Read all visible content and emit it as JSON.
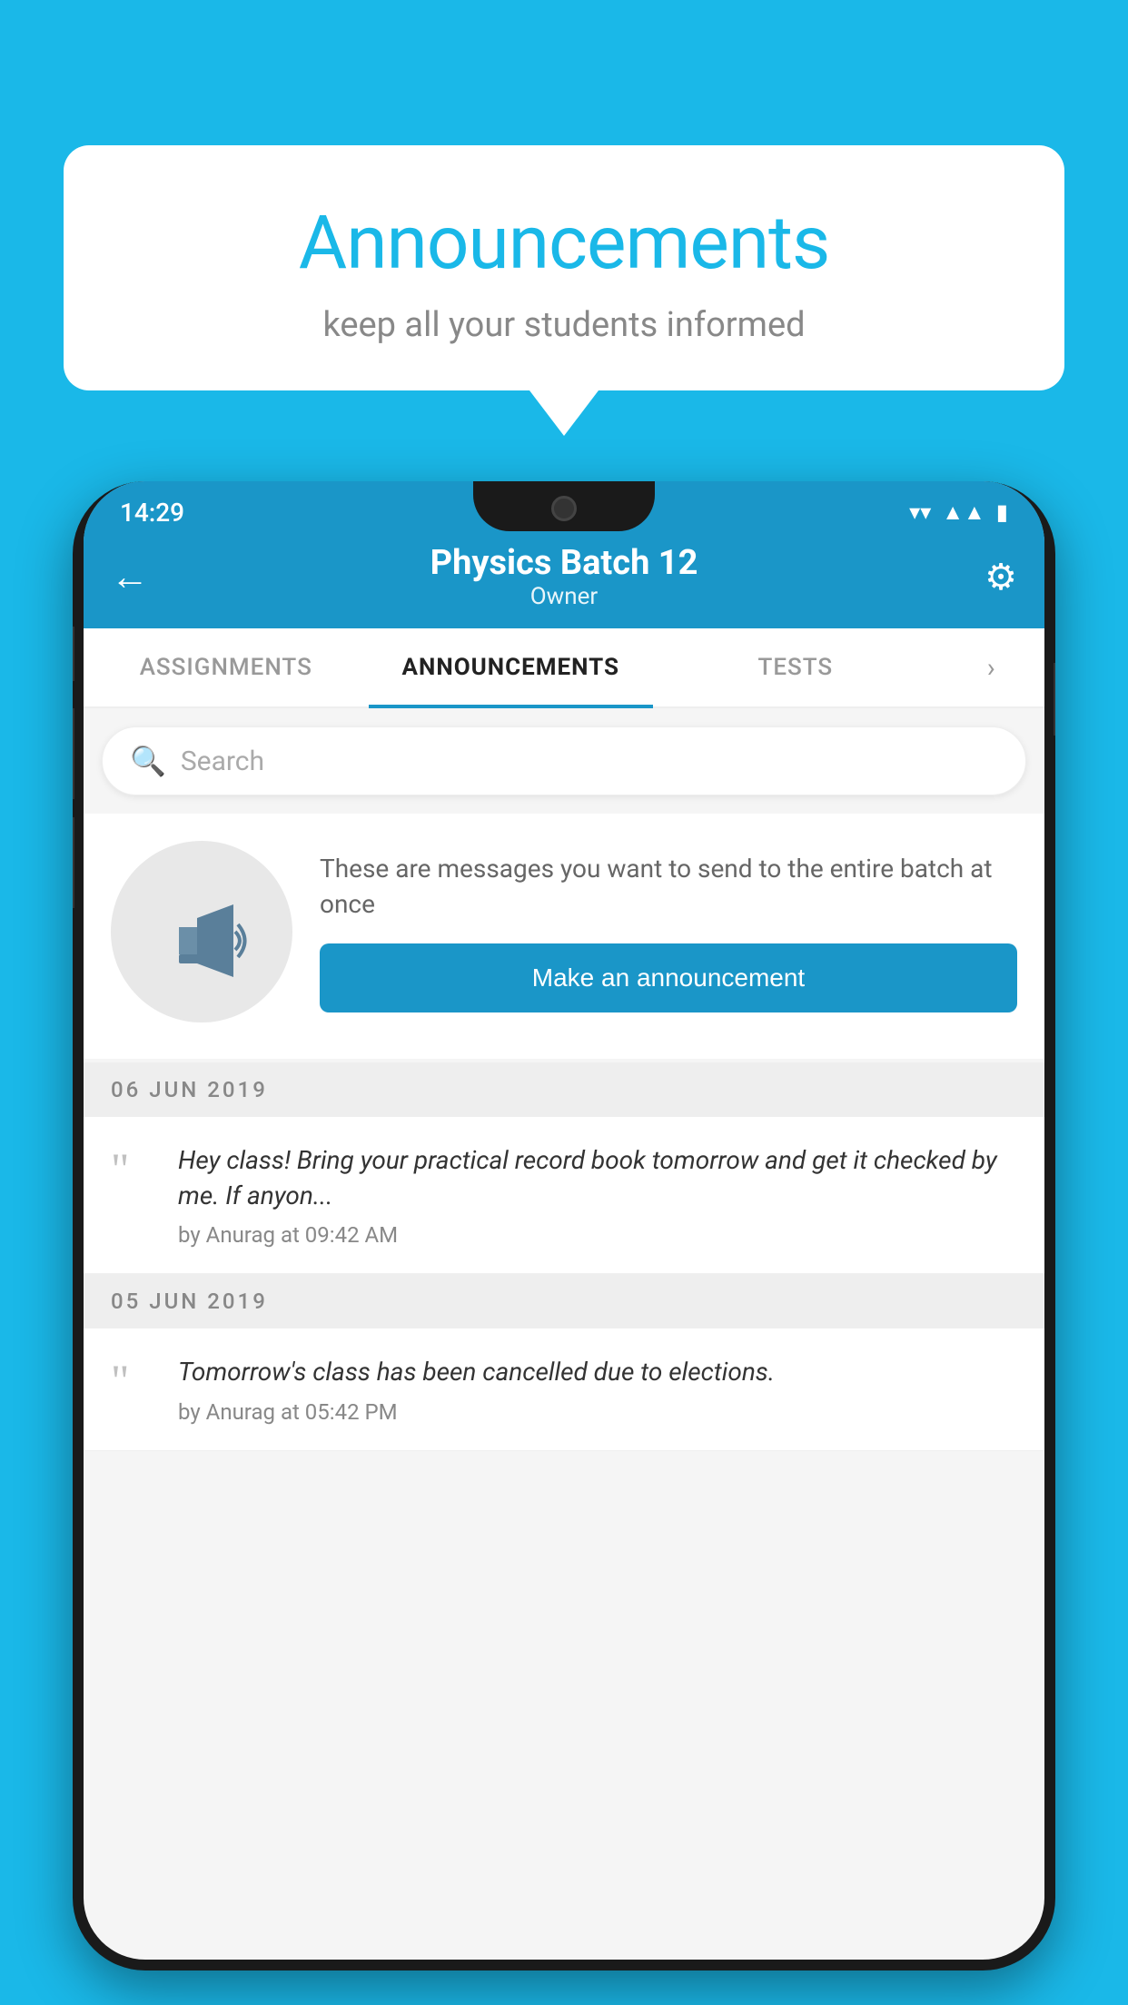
{
  "background": {
    "color": "#1ab8e8"
  },
  "speech_bubble": {
    "title": "Announcements",
    "subtitle": "keep all your students informed"
  },
  "phone": {
    "status_bar": {
      "time": "14:29",
      "icons": [
        "wifi",
        "signal",
        "battery"
      ]
    },
    "header": {
      "back_label": "←",
      "title": "Physics Batch 12",
      "subtitle": "Owner",
      "gear_label": "⚙"
    },
    "tabs": [
      {
        "label": "ASSIGNMENTS",
        "active": false
      },
      {
        "label": "ANNOUNCEMENTS",
        "active": true
      },
      {
        "label": "TESTS",
        "active": false
      }
    ],
    "search": {
      "placeholder": "Search"
    },
    "promo": {
      "text": "These are messages you want to send to the entire batch at once",
      "button_label": "Make an announcement"
    },
    "announcements": [
      {
        "date": "06  JUN  2019",
        "items": [
          {
            "text": "Hey class! Bring your practical record book tomorrow and get it checked by me. If anyon...",
            "meta": "by Anurag at 09:42 AM"
          }
        ]
      },
      {
        "date": "05  JUN  2019",
        "items": [
          {
            "text": "Tomorrow's class has been cancelled due to elections.",
            "meta": "by Anurag at 05:42 PM"
          }
        ]
      }
    ]
  }
}
